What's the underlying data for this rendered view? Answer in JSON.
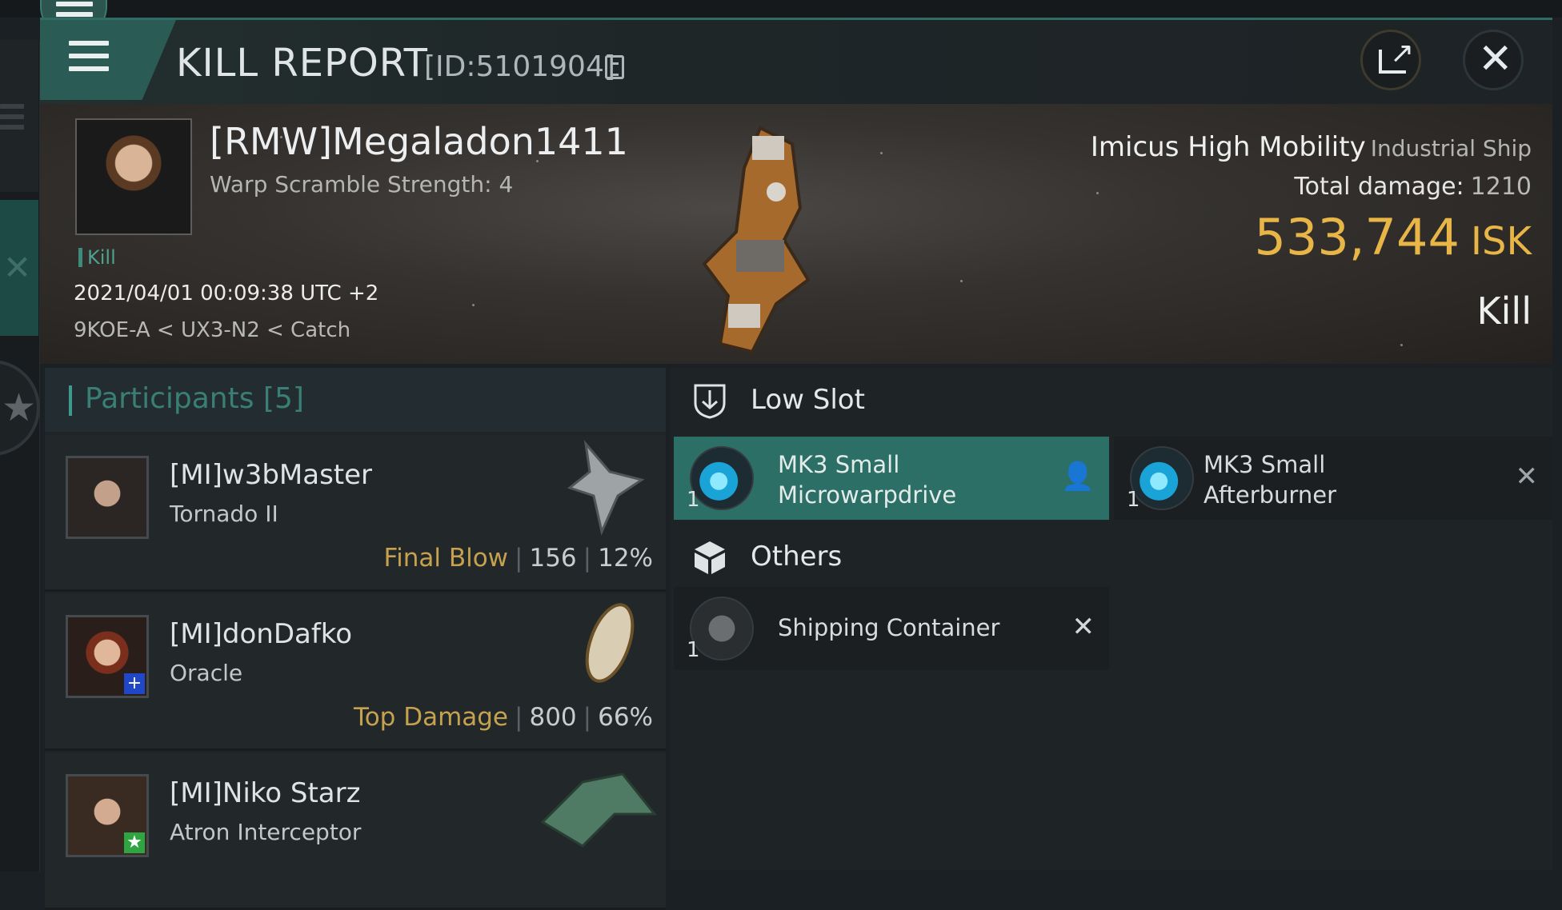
{
  "header": {
    "title": "KILL REPORT",
    "id_text": "[ID:5101904]"
  },
  "victim": {
    "name": "[RMW]Megaladon1411",
    "warp_scramble": "Warp Scramble Strength: 4",
    "tag": "Kill",
    "datetime": "2021/04/01 00:09:38 UTC +2",
    "location": "9KOE-A < UX3-N2 < Catch",
    "ship_name": "Imicus High Mobility",
    "ship_class": "Industrial Ship",
    "total_damage_label": "Total damage:",
    "total_damage": "1210",
    "isk_value": "533,744",
    "isk_unit": "ISK",
    "result": "Kill"
  },
  "participants": {
    "title": "Participants [5]",
    "rows": [
      {
        "name": "[MI]w3bMaster",
        "ship": "Tornado II",
        "tag": "Final Blow",
        "damage": "156",
        "percent": "12%"
      },
      {
        "name": "[MI]donDafko",
        "ship": "Oracle",
        "tag": "Top Damage",
        "damage": "800",
        "percent": "66%"
      },
      {
        "name": "[MI]Niko Starz",
        "ship": "Atron Interceptor"
      }
    ]
  },
  "fitting": {
    "low_slot_label": "Low Slot",
    "others_label": "Others",
    "low_items": [
      {
        "qty": "1",
        "line1": "MK3 Small",
        "line2": "Microwarpdrive"
      },
      {
        "qty": "1",
        "line1": "MK3 Small",
        "line2": "Afterburner"
      }
    ],
    "other_items": [
      {
        "qty": "1",
        "line1": "Shipping Container"
      }
    ]
  },
  "colors": {
    "accent": "#2c6f66",
    "isk": "#e8b547",
    "tag": "#c6a24f"
  }
}
